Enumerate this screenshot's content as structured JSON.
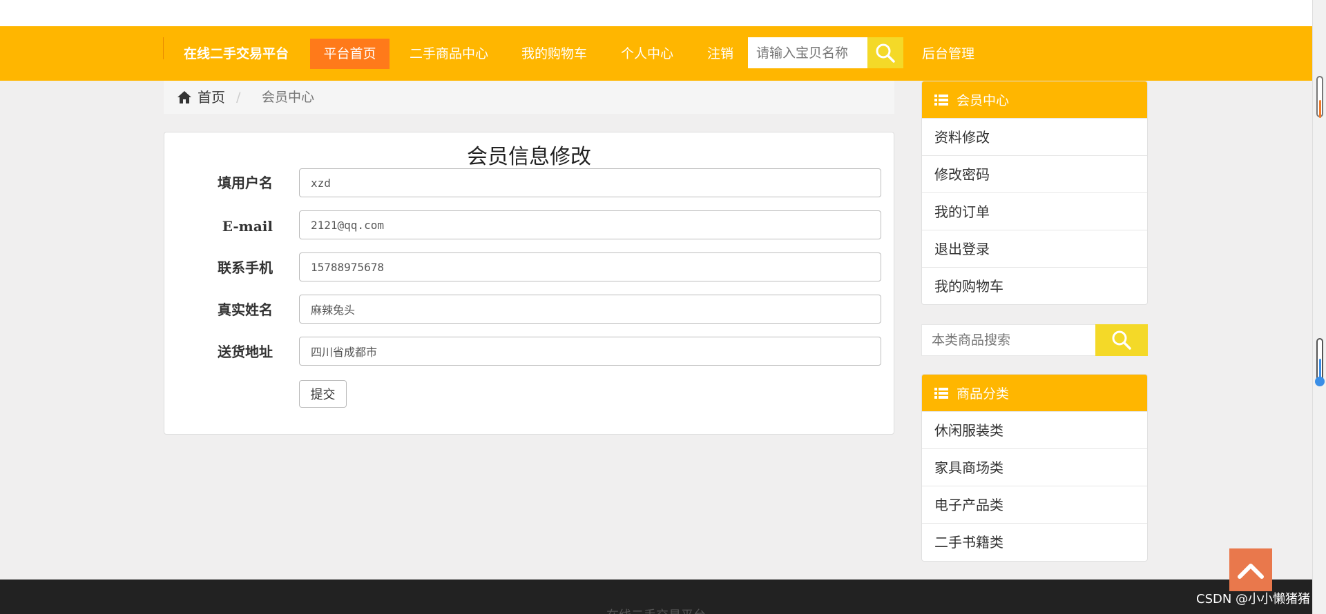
{
  "header": {
    "brand": "在线二手交易平台",
    "nav": [
      {
        "label": "平台首页",
        "active": true
      },
      {
        "label": "二手商品中心"
      },
      {
        "label": "我的购物车"
      },
      {
        "label": "个人中心"
      },
      {
        "label": "注销"
      }
    ],
    "search_placeholder": "请输入宝贝名称",
    "admin_label": "后台管理"
  },
  "breadcrumb": {
    "home": "首页",
    "separator": "/",
    "current": "会员中心"
  },
  "form": {
    "title": "会员信息修改",
    "fields": [
      {
        "label": "填用户名",
        "value": "xzd"
      },
      {
        "label": "E-mail",
        "value": "2121@qq.com"
      },
      {
        "label": "联系手机",
        "value": "15788975678"
      },
      {
        "label": "真实姓名",
        "value": "麻辣兔头"
      },
      {
        "label": "送货地址",
        "value": "四川省成都市"
      }
    ],
    "submit_label": "提交"
  },
  "sidebar": {
    "member_title": "会员中心",
    "member_items": [
      "资料修改",
      "修改密码",
      "我的订单",
      "退出登录",
      "我的购物车"
    ],
    "search_placeholder": "本类商品搜索",
    "category_title": "商品分类",
    "category_items": [
      "休闲服装类",
      "家具商场类",
      "电子产品类",
      "二手书籍类"
    ]
  },
  "footer": {
    "text": "在线二手交易平台"
  },
  "watermark": "CSDN @小小懒猪猪",
  "colors": {
    "brand_yellow": "#ffb600",
    "active_orange": "#ff7a1a",
    "search_yellow": "#f4d928",
    "to_top": "#e9784c",
    "footer_bg": "#222222"
  },
  "icons": {
    "search": "search-icon",
    "home": "home-icon",
    "list": "list-icon",
    "to_top": "chevron-up-icon"
  }
}
